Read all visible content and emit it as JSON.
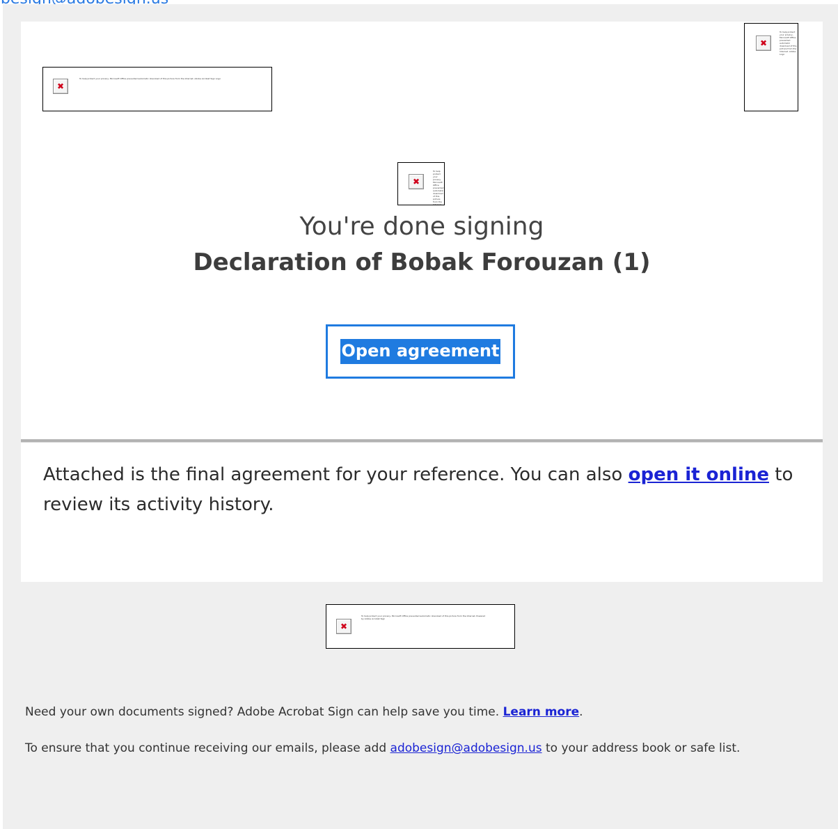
{
  "top_link": "adobesign@adobesign.us",
  "placeholders": {
    "alt_logo_left": "To help protect your privacy, Microsoft Office prevented automatic download of this picture from the Internet. Adobe Acrobat Sign Logo",
    "alt_logo_right": "To help protect your privacy, Microsoft Office prevented automatic download of this picture from the Internet. Adobe Logo",
    "alt_center": "To help protect your privacy, Microsoft Office prevented automatic download of this picture from the Internet.",
    "alt_footer": "To help protect your privacy, Microsoft Office prevented automatic download of this picture from the Internet. Powered by Adobe Acrobat Sign",
    "broken_icon": "broken-image-icon"
  },
  "heading": {
    "done_text": "You're done signing",
    "document_title": "Declaration of Bobak Forouzan (1)"
  },
  "open_button": {
    "label": "Open agreement"
  },
  "body": {
    "text_before": "Attached is the final agreement for your reference. You can also ",
    "link": "open it online",
    "text_after": " to review its activity history."
  },
  "footer": {
    "line1_before": "Need your own documents signed? Adobe Acrobat Sign can help save you time. ",
    "line1_link": "Learn more",
    "line1_after": ".",
    "line2_before": "To ensure that you continue receiving our emails, please add ",
    "line2_link": "adobesign@adobesign.us",
    "line2_after": " to your address book or safe list."
  },
  "colors": {
    "accent": "#1f7be0",
    "link": "#1a23d4",
    "frame_bg": "#efefef"
  }
}
